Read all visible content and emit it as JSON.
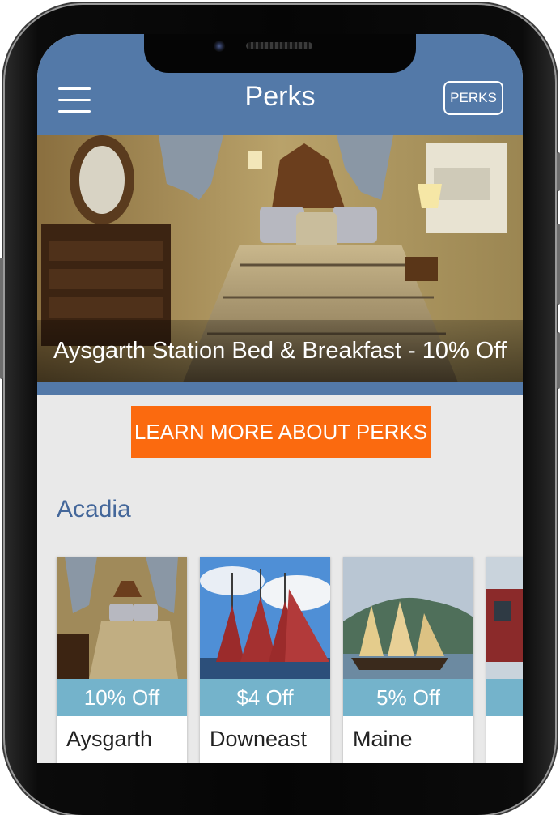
{
  "header": {
    "title": "Perks",
    "perks_button": "PERKS",
    "menu_icon": "hamburger-menu-icon",
    "color": "#5379a8"
  },
  "hero": {
    "caption": "Aysgarth Station Bed & Breakfast - 10% Off"
  },
  "cta": {
    "label": "LEARN MORE ABOUT PERKS",
    "color": "#fb6a0f"
  },
  "section": {
    "title": "Acadia"
  },
  "cards": [
    {
      "badge": "10% Off",
      "name": "Aysgarth"
    },
    {
      "badge": "$4 Off",
      "name": "Downeast"
    },
    {
      "badge": "5% Off",
      "name": "Maine"
    },
    {
      "badge": "",
      "name": ""
    }
  ],
  "colors": {
    "badge": "#74b3cb",
    "section_title": "#44679a"
  }
}
